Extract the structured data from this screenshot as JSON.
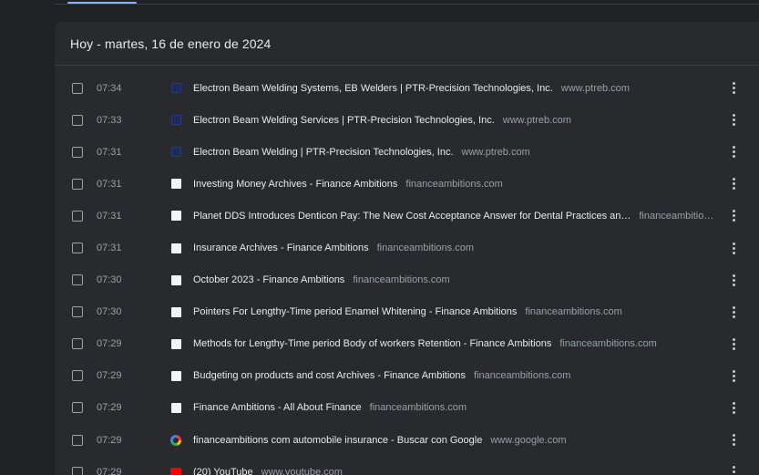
{
  "section": {
    "title": "Hoy - martes, 16 de enero de 2024"
  },
  "colors": {
    "background": "#202124",
    "card": "#292a2d",
    "accent": "#8ab4f8",
    "text_primary": "#e8eaed",
    "text_secondary": "#9aa0a6"
  },
  "entries": [
    {
      "time": "07:34",
      "title": "Electron Beam Welding Systems, EB Welders | PTR-Precision Technologies, Inc.",
      "domain": "www.ptreb.com",
      "icon": "ptr-favicon-icon"
    },
    {
      "time": "07:33",
      "title": "Electron Beam Welding Services | PTR-Precision Technologies, Inc.",
      "domain": "www.ptreb.com",
      "icon": "ptr-favicon-icon"
    },
    {
      "time": "07:31",
      "title": "Electron Beam Welding | PTR-Precision Technologies, Inc.",
      "domain": "www.ptreb.com",
      "icon": "ptr-favicon-icon"
    },
    {
      "time": "07:31",
      "title": "Investing Money Archives - Finance Ambitions",
      "domain": "financeambitions.com",
      "icon": "page-favicon-icon"
    },
    {
      "time": "07:31",
      "title": "Planet DDS Introduces Denticon Pay: The New Cost Acceptance Answer for Dental Practices an…",
      "domain": "financeambitio…",
      "icon": "page-favicon-icon"
    },
    {
      "time": "07:31",
      "title": "Insurance Archives - Finance Ambitions",
      "domain": "financeambitions.com",
      "icon": "page-favicon-icon"
    },
    {
      "time": "07:30",
      "title": "October 2023 - Finance Ambitions",
      "domain": "financeambitions.com",
      "icon": "page-favicon-icon"
    },
    {
      "time": "07:30",
      "title": "Pointers For Lengthy-Time period Enamel Whitening - Finance Ambitions",
      "domain": "financeambitions.com",
      "icon": "page-favicon-icon"
    },
    {
      "time": "07:29",
      "title": "Methods for Lengthy-Time period Body of workers Retention - Finance Ambitions",
      "domain": "financeambitions.com",
      "icon": "page-favicon-icon"
    },
    {
      "time": "07:29",
      "title": "Budgeting on products and cost Archives - Finance Ambitions",
      "domain": "financeambitions.com",
      "icon": "page-favicon-icon"
    },
    {
      "time": "07:29",
      "title": "Finance Ambitions - All About Finance",
      "domain": "financeambitions.com",
      "icon": "page-favicon-icon"
    },
    {
      "time": "07:29",
      "title": "financeambitions com automobile insurance - Buscar con Google",
      "domain": "www.google.com",
      "icon": "google-favicon-icon"
    },
    {
      "time": "07:29",
      "title": "(20) YouTube",
      "domain": "www.youtube.com",
      "icon": "youtube-favicon-icon"
    }
  ]
}
